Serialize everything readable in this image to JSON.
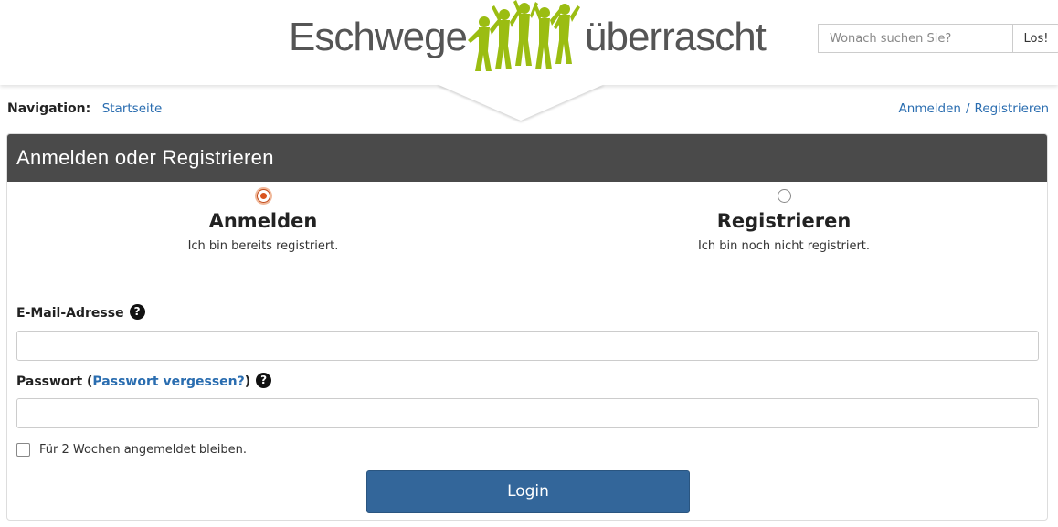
{
  "header": {
    "logo_left": "Eschwege",
    "logo_right": "überrascht",
    "logo_icon": "jumping-people-logo",
    "logo_color": "#9bbd12",
    "search_placeholder": "Wonach suchen Sie?",
    "search_button": "Los!"
  },
  "breadcrumb": {
    "label": "Navigation:",
    "home": "Startseite",
    "login": "Anmelden",
    "separator": "/",
    "register": "Registrieren"
  },
  "panel": {
    "title": "Anmelden oder Registrieren",
    "options": [
      {
        "title": "Anmelden",
        "description": "Ich bin bereits registriert.",
        "selected": true
      },
      {
        "title": "Registrieren",
        "description": "Ich bin noch nicht registriert.",
        "selected": false
      }
    ],
    "email_label": "E-Mail-Adresse",
    "email_value": "",
    "password_label": "Passwort (",
    "password_forgot": "Passwort vergessen?",
    "password_close": ")",
    "password_value": "",
    "help_icon": "question-circle-icon",
    "remember_label": "Für 2 Wochen angemeldet bleiben.",
    "remember_checked": false,
    "login_button": "Login"
  },
  "colors": {
    "panel_header": "#4a4a4a",
    "link": "#2a6db0",
    "button": "#33669a"
  }
}
